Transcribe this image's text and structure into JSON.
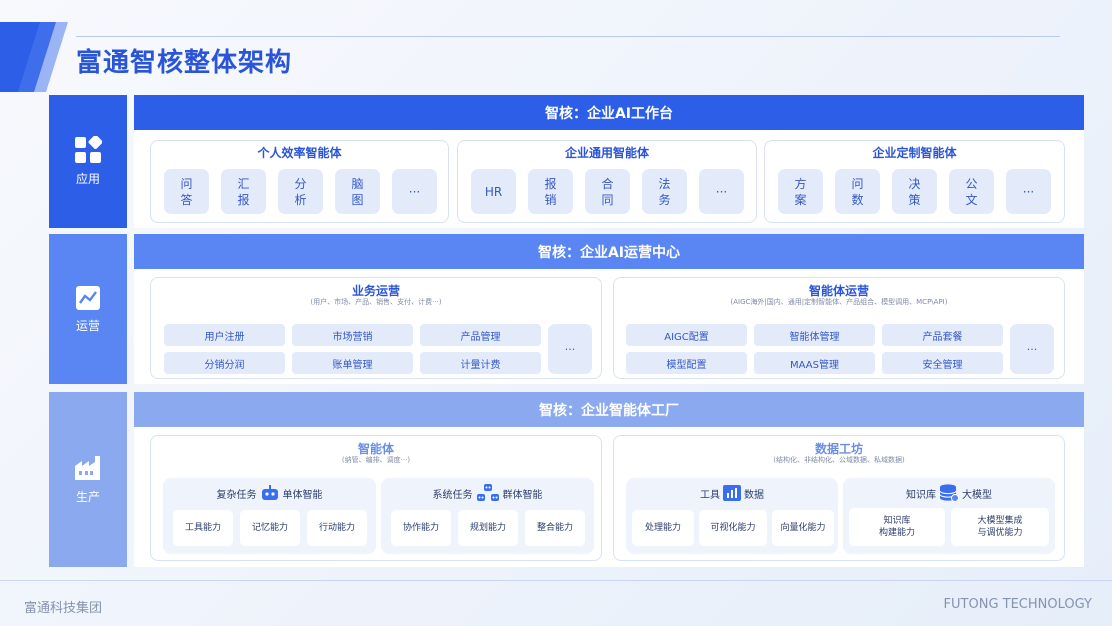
{
  "page_title": "富通智核整体架构",
  "footer": {
    "left": "富通科技集团",
    "right": "FUTONG TECHNOLOGY"
  },
  "colors": {
    "primary": "#2c5ee8",
    "mid": "#5a86f3",
    "light": "#8ba9ee",
    "tile": "#e3ebfb"
  },
  "layers": {
    "app": {
      "side_label": "应用",
      "side_icon": "grid-apps-icon",
      "band": "智核：企业AI工作台",
      "groups": [
        {
          "title": "个人效率智能体",
          "items": [
            "问\n答",
            "汇\n报",
            "分\n析",
            "脑\n图",
            "···"
          ]
        },
        {
          "title": "企业通用智能体",
          "items": [
            "HR",
            "报\n销",
            "合\n同",
            "法\n务",
            "···"
          ]
        },
        {
          "title": "企业定制智能体",
          "items": [
            "方\n案",
            "问\n数",
            "决\n策",
            "公\n文",
            "···"
          ]
        }
      ]
    },
    "ops": {
      "side_label": "运营",
      "side_icon": "trend-chart-icon",
      "band": "智核：企业AI运营中心",
      "groups": [
        {
          "title": "业务运营",
          "subtitle": "(用户、市场、产品、销售、支付、计费···)",
          "items": [
            "用户注册",
            "市场营销",
            "产品管理",
            "分销分润",
            "账单管理",
            "计量计费"
          ],
          "more": "···"
        },
        {
          "title": "智能体运营",
          "subtitle": "(AIGC海外|国内、通用|定制智能体、产品组合、模型调用、MCP\\API)",
          "items": [
            "AIGC配置",
            "智能体管理",
            "产品套餐",
            "模型配置",
            "MAAS管理",
            "安全管理"
          ],
          "more": "···"
        }
      ]
    },
    "prod": {
      "side_label": "生产",
      "side_icon": "factory-icon",
      "band": "智核：企业智能体工厂",
      "groups": [
        {
          "title": "智能体",
          "subtitle": "(纳管、编排、调度···)",
          "subs": [
            {
              "left": "复杂任务",
              "right": "单体智能",
              "icon": "robot-icon",
              "items": [
                "工具能力",
                "记忆能力",
                "行动能力"
              ]
            },
            {
              "left": "系统任务",
              "right": "群体智能",
              "icon": "robot-group-icon",
              "items": [
                "协作能力",
                "规划能力",
                "整合能力"
              ]
            }
          ]
        },
        {
          "title": "数据工坊",
          "subtitle": "(结构化、非结构化、公域数据、私域数据)",
          "subs": [
            {
              "left": "工具",
              "right": "数据",
              "icon": "bar-chart-icon",
              "items": [
                "处理能力",
                "可视化能力",
                "向量化能力"
              ]
            },
            {
              "left": "知识库",
              "right": "大模型",
              "icon": "database-icon",
              "items": [
                "知识库\n构建能力",
                "大模型集成\n与调优能力"
              ]
            }
          ]
        }
      ]
    }
  }
}
